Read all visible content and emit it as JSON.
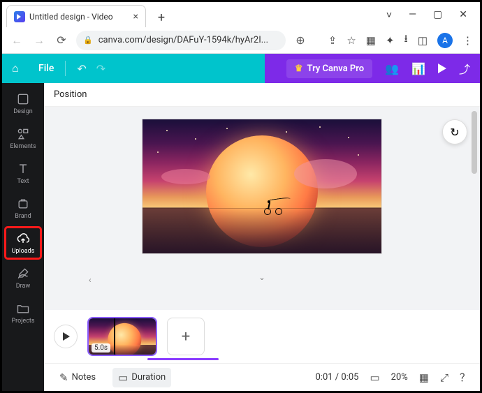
{
  "browser": {
    "tab_title": "Untitled design - Video",
    "url": "canva.com/design/DAFuY-1594k/hyAr2I...",
    "avatar_letter": "A"
  },
  "header": {
    "file_label": "File",
    "try_pro_label": "Try Canva Pro"
  },
  "sidebar": {
    "items": [
      {
        "id": "design",
        "label": "Design"
      },
      {
        "id": "elements",
        "label": "Elements"
      },
      {
        "id": "text",
        "label": "Text"
      },
      {
        "id": "brand",
        "label": "Brand"
      },
      {
        "id": "uploads",
        "label": "Uploads"
      },
      {
        "id": "draw",
        "label": "Draw"
      },
      {
        "id": "projects",
        "label": "Projects"
      }
    ],
    "highlighted": "uploads"
  },
  "toolbar": {
    "position_label": "Position"
  },
  "timeline": {
    "clip_duration": "5.0s"
  },
  "bottombar": {
    "notes_label": "Notes",
    "duration_label": "Duration",
    "time_display": "0:01 / 0:05",
    "zoom_label": "20%"
  }
}
